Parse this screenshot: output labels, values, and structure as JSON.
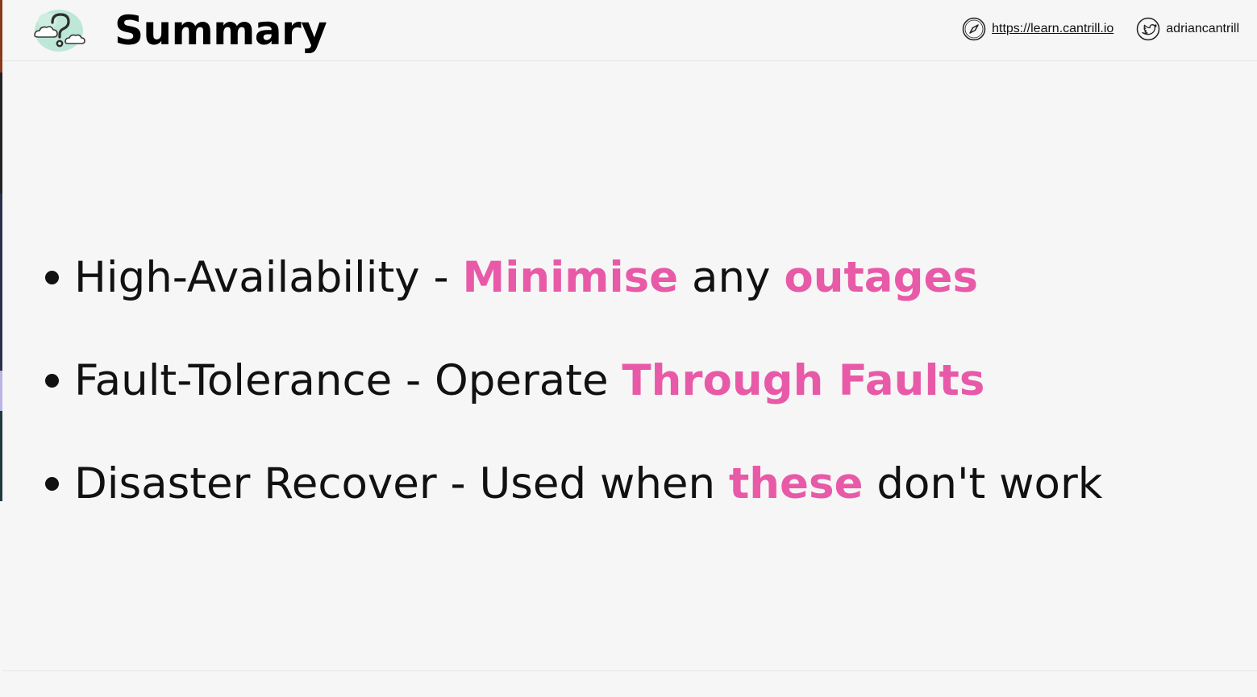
{
  "header": {
    "title": "Summary",
    "logo_icon": "question-cloud-icon",
    "links": {
      "website": {
        "icon": "compass-icon",
        "label": "https://learn.cantrill.io"
      },
      "twitter": {
        "icon": "twitter-bird-icon",
        "label": "adriancantrill"
      }
    }
  },
  "colors": {
    "highlight": "#e85aa8",
    "background": "#f6f6f6",
    "text": "#111111"
  },
  "bullets": [
    {
      "parts": [
        {
          "text": "High-Availability - ",
          "highlight": false
        },
        {
          "text": "Minimise",
          "highlight": true
        },
        {
          "text": " any ",
          "highlight": false
        },
        {
          "text": "outages",
          "highlight": true
        }
      ]
    },
    {
      "parts": [
        {
          "text": "Fault-Tolerance - Operate ",
          "highlight": false
        },
        {
          "text": "Through Faults",
          "highlight": true
        }
      ]
    },
    {
      "parts": [
        {
          "text": "Disaster Recover - Used when ",
          "highlight": false
        },
        {
          "text": "these",
          "highlight": true
        },
        {
          "text": " don't work",
          "highlight": false
        }
      ]
    }
  ]
}
